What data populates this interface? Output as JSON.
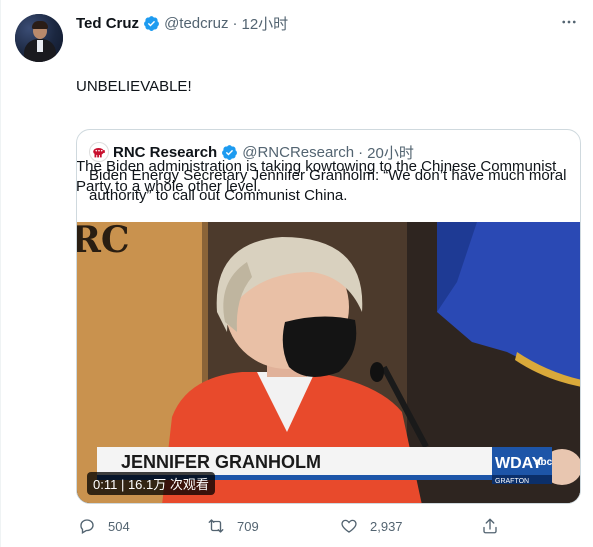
{
  "tweet": {
    "author_name": "Ted Cruz",
    "handle": "@tedcruz",
    "separator": "·",
    "time": "12小时",
    "text_line1": "UNBELIEVABLE!",
    "text_line2": "The Biden administration is taking kowtowing to the Chinese Communist Party to a whole other level."
  },
  "quote": {
    "author_name": "RNC Research",
    "handle": "@RNCResearch",
    "separator": "·",
    "time": "20小时",
    "text": "Biden Energy Secretary Jennifer Granholm: “We don’t have much moral authority” to call out Communist China.",
    "video": {
      "lower_third": "JENNIFER GRANHOLM",
      "station_logo": "WDAY",
      "station_sub": "abc",
      "station_place": "GRAFTON",
      "sign_text": "RC",
      "duration_label": "0:11 | 16.1万 次观看"
    }
  },
  "actions": {
    "replies": "504",
    "retweets": "709",
    "likes": "2,937"
  },
  "colors": {
    "verified": "#1d9bf0",
    "muted": "#536471",
    "border": "#cfd9de",
    "jacket": "#e84a2c",
    "flag": "#2a49b4"
  },
  "icons": [
    "more-icon",
    "verified-icon",
    "reply-icon",
    "retweet-icon",
    "like-icon",
    "share-icon",
    "rnc-logo-icon"
  ]
}
